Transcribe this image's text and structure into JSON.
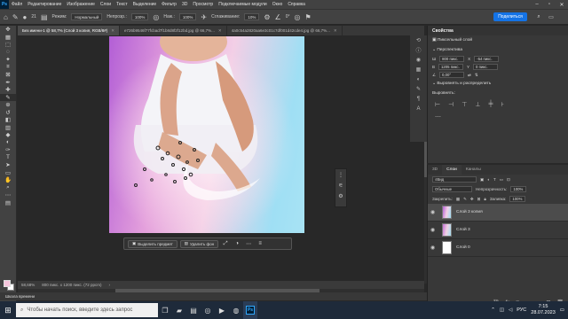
{
  "app": {
    "logo": "Ps"
  },
  "menu": [
    "Файл",
    "Редактирование",
    "Изображение",
    "Слои",
    "Текст",
    "Выделение",
    "Фильтр",
    "3D",
    "Просмотр",
    "Подключаемые модули",
    "Окно",
    "Справка"
  ],
  "options": {
    "brush_size": "21",
    "mode_label": "Режим:",
    "mode_value": "Нормальный",
    "opacity_label": "Непрозр.:",
    "opacity_value": "100%",
    "flow_label": "Наж.:",
    "flow_value": "100%",
    "smoothing_label": "Сглаживание:",
    "smoothing_value": "10%",
    "angle_value": "0°",
    "share_label": "Поделиться"
  },
  "tabs": [
    {
      "label": "Без имени-1 @ 58,7% (Слой 3 копия, RGB/8#)",
      "active": true
    },
    {
      "label": "e726b9546f77fcbad7f1b8d8f2f12bd.jpg @ 66,7%...",
      "active": false
    },
    {
      "label": "4a0c54a2820aa6e3c01c7df001d42cde4.jpg @ 66,7%...",
      "active": false
    }
  ],
  "context_bar": {
    "select_subject": "Выделить предмет",
    "remove_bg": "Удалить фон"
  },
  "status": {
    "zoom": "58,68%",
    "size": "800 пикс. x 1200 пикс. (72 ppcm)"
  },
  "timeline_label": "Шкала времени",
  "properties": {
    "header": "Свойства",
    "kind": "Пиксельный слой",
    "transform_section": "Перспектива",
    "w_label": "Ш",
    "w_value": "800 пикс.",
    "x_label": "X",
    "x_value": "-54 пикс.",
    "h_label": "В",
    "h_value": "1205 пикс.",
    "y_label": "Y",
    "y_value": "0 пикс.",
    "angle_value": "0,00°",
    "align_section": "Выровнять и распределить",
    "align_label": "Выровнять:"
  },
  "layers_panel": {
    "tabs": [
      "3D",
      "Слои",
      "Каналы"
    ],
    "filter_label": "Вид",
    "blend_mode": "Обычные",
    "opacity_label": "Непрозрачность:",
    "opacity_value": "100%",
    "lock_label": "Закрепить:",
    "fill_label": "Заливка:",
    "fill_value": "100%",
    "layers": [
      {
        "name": "Слой 3 копия",
        "active": true
      },
      {
        "name": "Слой 3",
        "active": false
      },
      {
        "name": "Слой 0",
        "active": false
      }
    ]
  },
  "taskbar": {
    "search_placeholder": "Чтобы начать поиск, введите здесь запрос",
    "lang": "РУС",
    "time": "7:15",
    "date": "28.07.2023"
  },
  "colors": {
    "accent": "#1473e6",
    "fg_swatch": "#f6c6dc",
    "bg_swatch": "#ffffff"
  },
  "icons": [
    "brush-icon",
    "move-icon",
    "marquee-icon",
    "lasso-icon",
    "magic-wand-icon",
    "crop-icon",
    "eyedropper-icon",
    "healing-icon",
    "brush-tool-icon",
    "clone-icon",
    "history-brush-icon",
    "eraser-icon",
    "gradient-icon",
    "blur-icon",
    "dodge-icon",
    "pen-icon",
    "type-icon",
    "path-select-icon",
    "shape-icon",
    "hand-icon",
    "zoom-icon",
    "more-tools-icon"
  ]
}
